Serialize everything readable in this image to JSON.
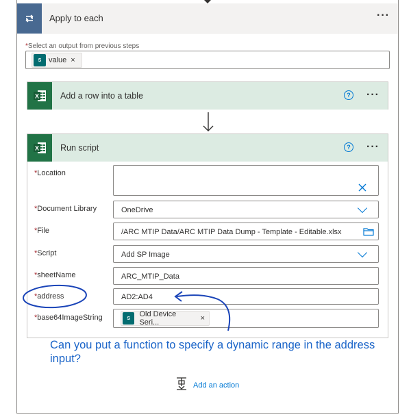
{
  "apply_to_each": {
    "title": "Apply to each",
    "more": "···",
    "select_label": "Select an output from previous steps",
    "token_label": "value",
    "token_close": "×"
  },
  "add_row": {
    "title": "Add a row into a table",
    "help": "?",
    "more": "···"
  },
  "run_script": {
    "title": "Run script",
    "help": "?",
    "more": "···",
    "fields": {
      "location": {
        "label": "Location",
        "value": ""
      },
      "document_library": {
        "label": "Document Library",
        "value": "OneDrive"
      },
      "file": {
        "label": "File",
        "value": "/ARC MTIP Data/ARC MTIP Data Dump - Template - Editable.xlsx"
      },
      "script": {
        "label": "Script",
        "value": "Add SP Image"
      },
      "sheet_name": {
        "label": "sheetName",
        "value": "ARC_MTIP_Data"
      },
      "address": {
        "label": "address",
        "value": "AD2:AD4"
      },
      "base64": {
        "label": "base64ImageString",
        "token": "Old Device Seri...",
        "token_close": "×"
      }
    }
  },
  "annotation": {
    "note": "Can you put a function to specify a dynamic range in the address input?"
  },
  "add_action": {
    "label": "Add an action"
  },
  "colors": {
    "accent": "#0078d4",
    "excel_green": "#217346",
    "sharepoint_teal": "#036c70",
    "loop_blue": "#486991",
    "annotation_blue": "#1a64c8",
    "card_header": "#dcebe2"
  },
  "icons": {
    "loop": "loop-icon",
    "excel": "excel-icon",
    "sharepoint": "sharepoint-icon",
    "close": "close-icon",
    "chevron": "chevron-down-icon",
    "folder": "folder-icon",
    "help": "help-icon",
    "arrow_down": "arrow-down-icon",
    "add_action": "add-action-icon"
  }
}
